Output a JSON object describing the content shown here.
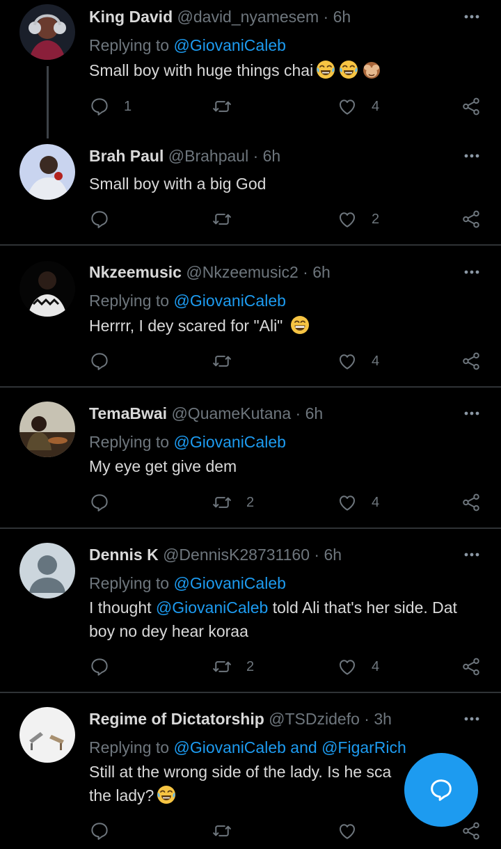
{
  "icons": {
    "reply": "speech-bubble-icon",
    "retweet": "retweet-icon",
    "like": "heart-icon",
    "share": "share-icon",
    "more": "more-dots-icon",
    "compose": "compose-reply-icon"
  },
  "colors": {
    "background": "#000000",
    "accent": "#1d9bf0",
    "muted": "#6e767d",
    "divider": "#2f3336"
  },
  "tweets": [
    {
      "name": "King David",
      "handle": "@david_nyamesem",
      "dot": "·",
      "time": "6h",
      "replying_label": "Replying to",
      "replying_to": "@GiovaniCaleb",
      "text": "Small boy with huge things chai",
      "emojis": [
        "face-with-tears-of-joy",
        "face-with-tears-of-joy",
        "see-no-evil-monkey"
      ],
      "reply_count": "1",
      "retweet_count": "",
      "like_count": "4"
    },
    {
      "name": "Brah Paul",
      "handle": "@Brahpaul",
      "dot": "·",
      "time": "6h",
      "text": "Small boy with a big God",
      "reply_count": "",
      "retweet_count": "",
      "like_count": "2"
    },
    {
      "name": "Nkzeemusic",
      "handle": "@Nkzeemusic2",
      "dot": "·",
      "time": "6h",
      "replying_label": "Replying to",
      "replying_to": "@GiovaniCaleb",
      "text": "Herrrr, I dey scared for \"Ali\"",
      "emojis": [
        "grinning-face-with-smiling-eyes"
      ],
      "reply_count": "",
      "retweet_count": "",
      "like_count": "4"
    },
    {
      "name": "TemaBwai",
      "handle": "@QuameKutana",
      "dot": "·",
      "time": "6h",
      "replying_label": "Replying to",
      "replying_to": "@GiovaniCaleb",
      "text": "My eye get give dem",
      "reply_count": "",
      "retweet_count": "2",
      "like_count": "4"
    },
    {
      "name": "Dennis K",
      "handle": "@DennisK28731160",
      "dot": "·",
      "time": "6h",
      "replying_label": "Replying to",
      "replying_to": "@GiovaniCaleb",
      "text_before": "I thought",
      "text_mention": "@GiovaniCaleb",
      "text_after": "told Ali that's her side. Dat boy no dey hear koraa",
      "reply_count": "",
      "retweet_count": "2",
      "like_count": "4"
    },
    {
      "name": "Regime of Dictatorship",
      "handle": "@TSDzidefo",
      "dot": "·",
      "time": "3h",
      "replying_label": "Replying to",
      "replying_to": "@GiovaniCaleb",
      "replying_and": "and",
      "replying_to_2": "@FigarRich",
      "text": "Still at the wrong side of the lady. Is he sca the lady?",
      "emojis": [
        "face-with-tears-of-joy"
      ],
      "reply_count": "",
      "retweet_count": "",
      "like_count": ""
    }
  ]
}
